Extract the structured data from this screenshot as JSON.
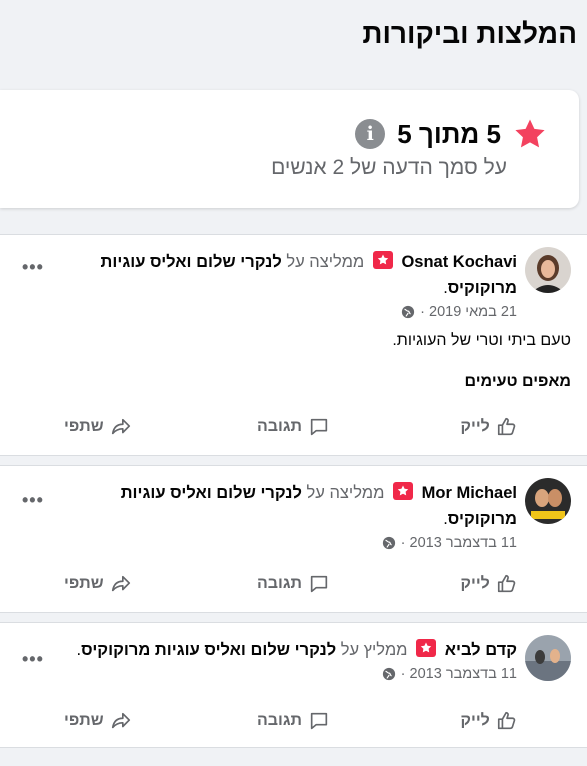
{
  "page_title": "המלצות וביקורות",
  "rating": {
    "score_text": "5 מתוך 5",
    "based_on": "על סמך הדעה של 2 אנשים",
    "star_color": "#f3425f"
  },
  "reviews": [
    {
      "author": "Osnat Kochavi",
      "verb": "ממליצה על",
      "page": "לנקרי שלום ואליס עוגיות מרוקוקיס",
      "date": "21 במאי 2019 ·",
      "text": "טעם ביתי וטרי של העוגיות.",
      "tags": "מאפים טעימים"
    },
    {
      "author": "Mor Michael",
      "verb": "ממליצה על",
      "page": "לנקרי שלום ואליס עוגיות מרוקוקיס",
      "date": "11 בדצמבר 2013 ·"
    },
    {
      "author": "קדם לביא",
      "verb": "ממליץ על",
      "page": "לנקרי שלום ואליס עוגיות מרוקוקיס",
      "date": "11 בדצמבר 2013 ·"
    }
  ],
  "actions": {
    "like": "לייק",
    "comment": "תגובה",
    "share": "שתפי"
  },
  "icons": {
    "star": "star-icon",
    "info": "info-icon",
    "recommend": "recommend-flag-icon",
    "globe": "globe-icon",
    "more": "more-options-icon",
    "like": "thumbs-up-icon",
    "comment": "comment-bubble-icon",
    "share": "share-arrow-icon"
  }
}
